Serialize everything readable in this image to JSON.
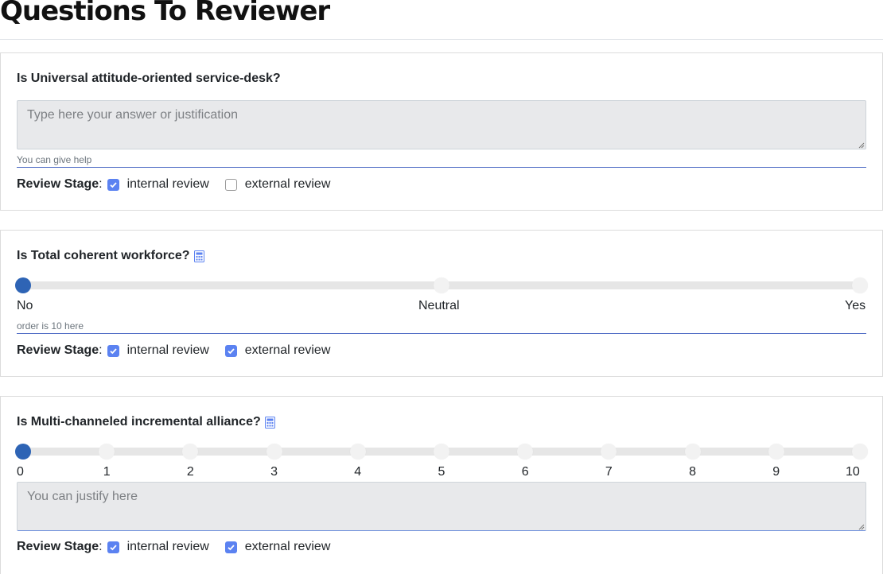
{
  "page": {
    "title": "Questions To Reviewer"
  },
  "questions": [
    {
      "title": "Is Universal attitude-oriented service-desk?",
      "answer_placeholder": "Type here your answer or justification",
      "help": "You can give help",
      "stage_label": "Review Stage",
      "stages": [
        {
          "label": "internal review",
          "checked": true
        },
        {
          "label": "external review",
          "checked": false
        }
      ]
    },
    {
      "title": "Is Total coherent workforce?",
      "icon": "calculator-icon",
      "slider": {
        "labels": [
          "No",
          "Neutral",
          "Yes"
        ],
        "value": "No"
      },
      "help": "order is 10 here",
      "stage_label": "Review Stage",
      "stages": [
        {
          "label": "internal review",
          "checked": true
        },
        {
          "label": "external review",
          "checked": true
        }
      ]
    },
    {
      "title": "Is Multi-channeled incremental alliance?",
      "icon": "calculator-icon",
      "slider": {
        "labels": [
          "0",
          "1",
          "2",
          "3",
          "4",
          "5",
          "6",
          "7",
          "8",
          "9",
          "10"
        ],
        "value": 0
      },
      "answer_placeholder": "You can justify here",
      "stage_label": "Review Stage",
      "stages": [
        {
          "label": "internal review",
          "checked": true
        },
        {
          "label": "external review",
          "checked": true
        }
      ]
    }
  ],
  "colors": {
    "accent": "#5b82f1",
    "knob": "#2e64b5",
    "help_rule": "#5470c6"
  }
}
